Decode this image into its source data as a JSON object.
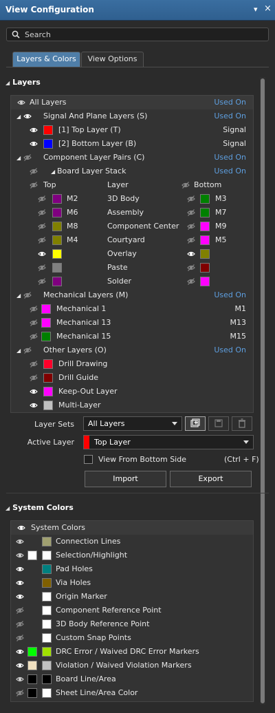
{
  "window": {
    "title": "View Configuration",
    "pin_icon": "▾",
    "close_icon": "×"
  },
  "search": {
    "placeholder": "Search"
  },
  "tabs": [
    {
      "label": "Layers & Colors"
    },
    {
      "label": "View Options"
    }
  ],
  "layers_section": {
    "title": "Layers"
  },
  "used_on": "Used On",
  "layers": {
    "all_layers": "All Layers",
    "signal_group": "Signal And Plane Layers (S)",
    "signal": [
      {
        "label": "[1] Top Layer (T)",
        "type": "Signal",
        "color": "#ff0000"
      },
      {
        "label": "[2] Bottom Layer (B)",
        "type": "Signal",
        "color": "#0000ff"
      }
    ],
    "pairs_group": "Component Layer Pairs (C)",
    "stack_group": "Board Layer Stack",
    "pair_headers": {
      "top": "Top",
      "layer": "Layer",
      "bottom": "Bottom"
    },
    "pairs": [
      {
        "top_code": "M2",
        "top_color": "#800080",
        "layer": "3D Body",
        "bottom_code": "M3",
        "bottom_color": "#008000",
        "top_visible": false,
        "bottom_visible": false
      },
      {
        "top_code": "M6",
        "top_color": "#800080",
        "layer": "Assembly",
        "bottom_code": "M7",
        "bottom_color": "#008000",
        "top_visible": false,
        "bottom_visible": false
      },
      {
        "top_code": "M8",
        "top_color": "#808000",
        "layer": "Component Center",
        "bottom_code": "M9",
        "bottom_color": "#ff00ff",
        "top_visible": false,
        "bottom_visible": false
      },
      {
        "top_code": "M4",
        "top_color": "#808000",
        "layer": "Courtyard",
        "bottom_code": "M5",
        "bottom_color": "#ff00ff",
        "top_visible": false,
        "bottom_visible": false
      },
      {
        "top_code": "",
        "top_color": "#ffff00",
        "layer": "Overlay",
        "bottom_code": "",
        "bottom_color": "#808000",
        "top_visible": true,
        "bottom_visible": true
      },
      {
        "top_code": "",
        "top_color": "#808080",
        "layer": "Paste",
        "bottom_code": "",
        "bottom_color": "#800000",
        "top_visible": false,
        "bottom_visible": false
      },
      {
        "top_code": "",
        "top_color": "#800080",
        "layer": "Solder",
        "bottom_code": "",
        "bottom_color": "#ff00ff",
        "top_visible": false,
        "bottom_visible": false
      }
    ],
    "mech_group": "Mechanical Layers (M)",
    "mech": [
      {
        "label": "Mechanical 1",
        "code": "M1",
        "color": "#ff00ff"
      },
      {
        "label": "Mechanical 13",
        "code": "M13",
        "color": "#ff00ff"
      },
      {
        "label": "Mechanical 15",
        "code": "M15",
        "color": "#008000"
      }
    ],
    "other_group": "Other Layers (O)",
    "other": [
      {
        "label": "Drill Drawing",
        "color": "#ff002a",
        "visible": false
      },
      {
        "label": "Drill Guide",
        "color": "#800000",
        "visible": false
      },
      {
        "label": "Keep-Out Layer",
        "color": "#ff00ff",
        "visible": true
      },
      {
        "label": "Multi-Layer",
        "color": "#c0c0c0",
        "visible": true
      }
    ]
  },
  "layer_sets": {
    "label": "Layer Sets",
    "value": "All Layers"
  },
  "active_layer": {
    "label": "Active Layer",
    "value": "Top Layer",
    "color": "#ff0000"
  },
  "view_from_bottom": {
    "label": "View From Bottom Side",
    "shortcut": "(Ctrl + F)"
  },
  "buttons": {
    "import": "Import",
    "export": "Export"
  },
  "system_section": {
    "title": "System Colors"
  },
  "system_header": "System Colors",
  "system_colors": [
    {
      "label": "Connection Lines",
      "visible": true,
      "bright": false,
      "c1": null,
      "c2": "#a0a070"
    },
    {
      "label": "Selection/Highlight",
      "visible": true,
      "bright": false,
      "c1": "#ffffff",
      "c2": "#ffffff"
    },
    {
      "label": "Pad Holes",
      "visible": true,
      "bright": true,
      "c1": null,
      "c2": "#008080"
    },
    {
      "label": "Via Holes",
      "visible": true,
      "bright": true,
      "c1": null,
      "c2": "#806000"
    },
    {
      "label": "Origin Marker",
      "visible": true,
      "bright": true,
      "c1": null,
      "c2": "#ffffff"
    },
    {
      "label": "Component Reference Point",
      "visible": false,
      "bright": false,
      "c1": null,
      "c2": "#ffffff"
    },
    {
      "label": "3D Body Reference Point",
      "visible": false,
      "bright": false,
      "c1": null,
      "c2": "#ffffff"
    },
    {
      "label": "Custom Snap Points",
      "visible": false,
      "bright": false,
      "c1": null,
      "c2": "#ffffff"
    },
    {
      "label": "DRC Error / Waived DRC Error Markers",
      "visible": true,
      "bright": true,
      "c1": "#00ff00",
      "c2": "#a0e000"
    },
    {
      "label": "Violation / Waived Violation Markers",
      "visible": true,
      "bright": true,
      "c1": "#f0e0c0",
      "c2": "#c0c0c0"
    },
    {
      "label": "Board Line/Area",
      "visible": true,
      "bright": false,
      "c1": "#000000",
      "c2": "#000000"
    },
    {
      "label": "Sheet Line/Area Color",
      "visible": false,
      "bright": false,
      "c1": "#000000",
      "c2": "#ffffff"
    }
  ]
}
